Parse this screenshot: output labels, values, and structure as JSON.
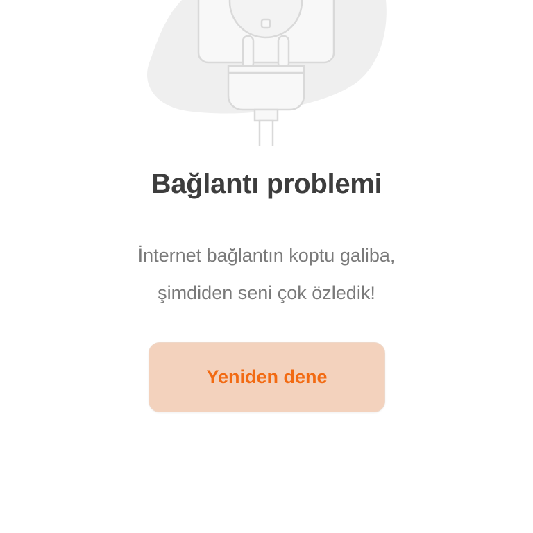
{
  "error": {
    "title": "Bağlantı problemi",
    "message_line1": "İnternet bağlantın koptu galiba,",
    "message_line2": "şimdiden seni çok özledik!",
    "retry_label": "Yeniden dene"
  },
  "illustration": {
    "icon": "unplugged-plug-socket-icon"
  },
  "colors": {
    "title": "#3d3d3d",
    "message": "#7a7a7a",
    "button_bg": "#f3d2bd",
    "button_text": "#f26a12",
    "illustration_blob": "#efefef",
    "illustration_stroke": "#d9d9d9"
  }
}
